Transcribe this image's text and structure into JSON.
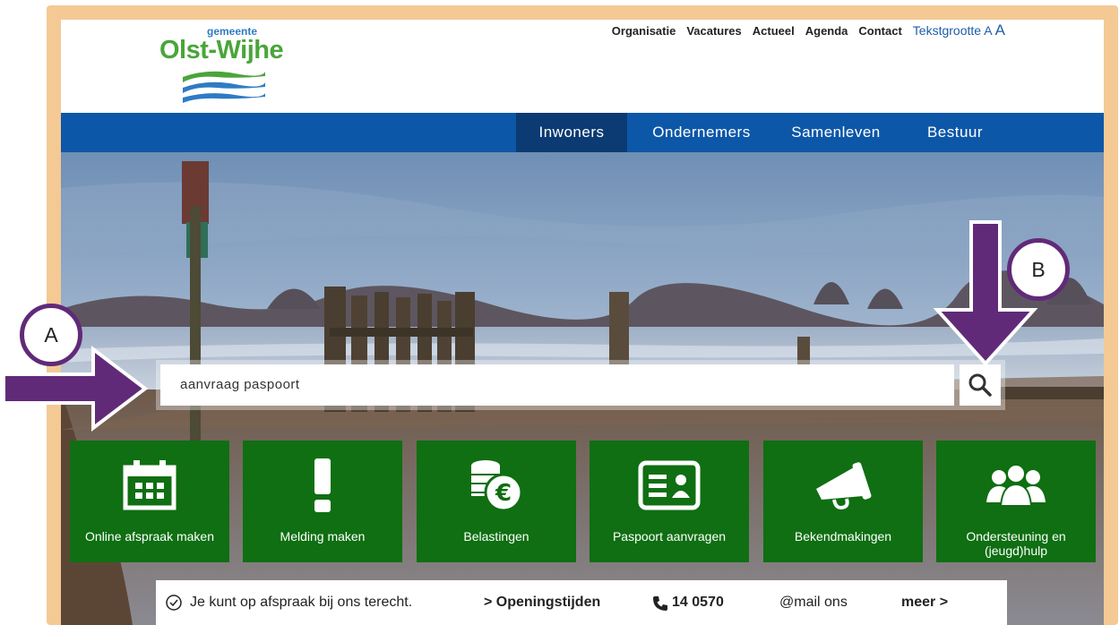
{
  "logo": {
    "small": "gemeente",
    "big": "Olst-Wijhe"
  },
  "toplinks": [
    "Organisatie",
    "Vacatures",
    "Actueel",
    "Agenda",
    "Contact"
  ],
  "tekstgrootte": {
    "label": "Tekstgrootte",
    "a_small": "A",
    "a_large": "A"
  },
  "nav": [
    "Inwoners",
    "Ondernemers",
    "Samenleven",
    "Bestuur"
  ],
  "search": {
    "value": "aanvraag paspoort"
  },
  "tiles": [
    "Online afspraak maken",
    "Melding maken",
    "Belastingen",
    "Paspoort aanvragen",
    "Bekendmakingen",
    "Ondersteuning en (jeugd)hulp"
  ],
  "infobar": {
    "appointment": "Je kunt op afspraak bij ons terecht.",
    "hours": "> Openingstijden",
    "phone": "14 0570",
    "mail": "@mail ons",
    "more": "meer >"
  },
  "annotations": {
    "a": "A",
    "b": "B"
  },
  "colors": {
    "accent": "#612a78",
    "nav": "#0d57a8",
    "nav_active": "#0b3b72",
    "tile": "#0f6f12",
    "frame": "#f4c994"
  }
}
